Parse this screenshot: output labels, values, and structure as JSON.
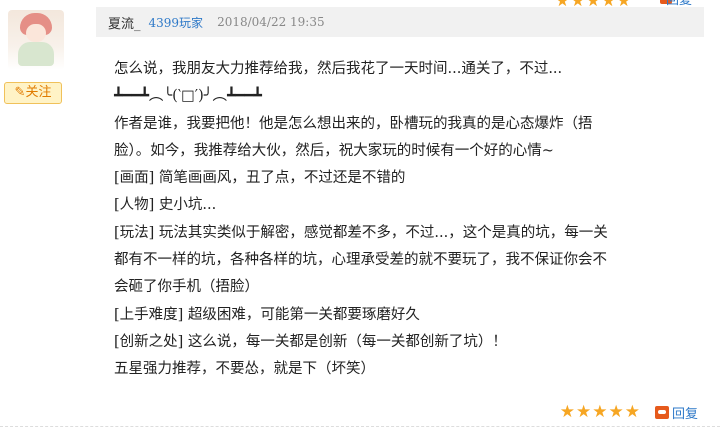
{
  "prev_item": {
    "stars": "★★★★★",
    "reply_label": "回复"
  },
  "profile": {
    "follow_label": "✎关注"
  },
  "comment": {
    "username": "夏流_",
    "user_tag": "4399玩家",
    "datetime": "2018/04/22 19:35",
    "lines": [
      "怎么说，我朋友大力推荐给我，然后我花了一天时间...通关了，不过...",
      "┻━━┻︵╰(‵□′)╯︵┻━━┻",
      "作者是谁，我要把他！他是怎么想出来的，卧槽玩的我真的是心态爆炸（捂",
      "脸）。如今，我推荐给大伙，然后，祝大家玩的时候有一个好的心情~",
      "[画面] 简笔画画风，丑了点，不过还是不错的",
      "[人物] 史小坑...",
      "[玩法] 玩法其实类似于解密，感觉都差不多，不过...，这个是真的坑，每一关",
      "都有不一样的坑，各种各样的坑，心理承受差的就不要玩了，我不保证你会不",
      "会砸了你手机（捂脸）",
      "[上手难度] 超级困难，可能第一关都要琢磨好久",
      "[创新之处] 这么说，每一关都是创新（每一关都创新了坑）！",
      "五星强力推荐，不要怂，就是下（坏笑）"
    ],
    "rating": 5,
    "stars": "★★★★★",
    "reply_label": "回复"
  }
}
